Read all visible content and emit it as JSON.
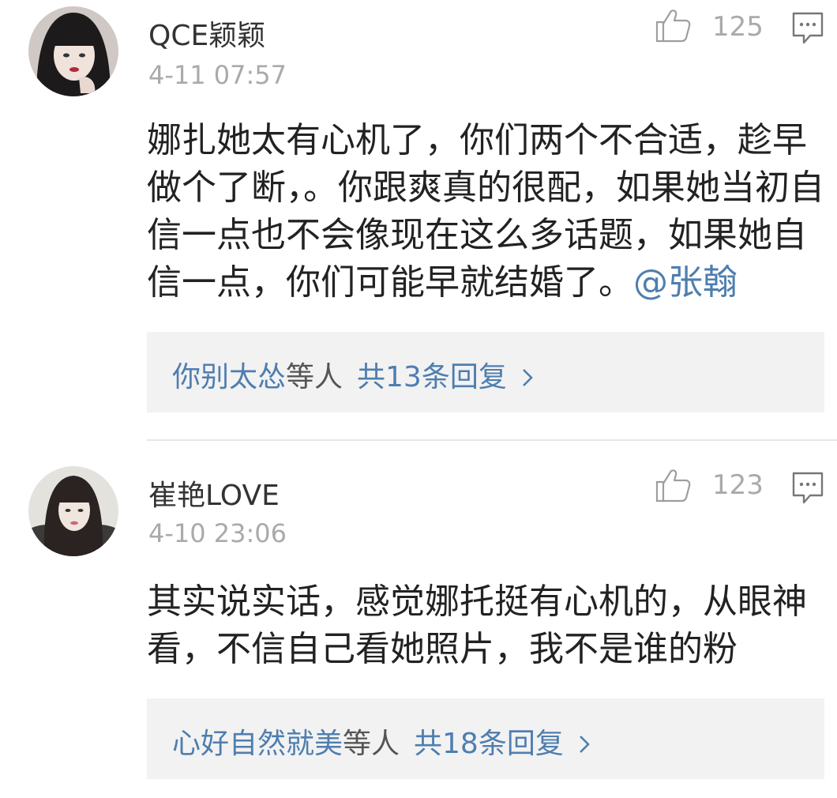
{
  "comments": [
    {
      "username": "QCE颖颖",
      "timestamp": "4-11 07:57",
      "likes": "125",
      "text": "娜扎她太有心机了，你们两个不合适，趁早做个了断，。你跟爽真的很配，如果她当初自信一点也不会像现在这么多话题，如果她自信一点，你们可能早就结婚了。",
      "mention": "@张翰",
      "replies": {
        "first_user": "你别太怂",
        "others_label": "等人",
        "count_label": "共13条回复"
      },
      "icons": {
        "avatar": "avatar-icon",
        "like": "thumbs-up-icon",
        "reply": "comment-bubble-icon",
        "chevron": "chevron-right-icon"
      }
    },
    {
      "username": "崔艳LOVE",
      "timestamp": "4-10 23:06",
      "likes": "123",
      "text": "其实说实话，感觉娜托挺有心机的，从眼神看，不信自己看她照片，我不是谁的粉",
      "mention": "",
      "replies": {
        "first_user": "心好自然就美",
        "others_label": "等人",
        "count_label": "共18条回复"
      },
      "icons": {
        "avatar": "avatar-icon",
        "like": "thumbs-up-icon",
        "reply": "comment-bubble-icon",
        "chevron": "chevron-right-icon"
      }
    }
  ],
  "colors": {
    "link": "#4f7eaf",
    "meta": "#aaaaaa",
    "text": "#222222",
    "reply_box_bg": "#f2f2f2"
  }
}
